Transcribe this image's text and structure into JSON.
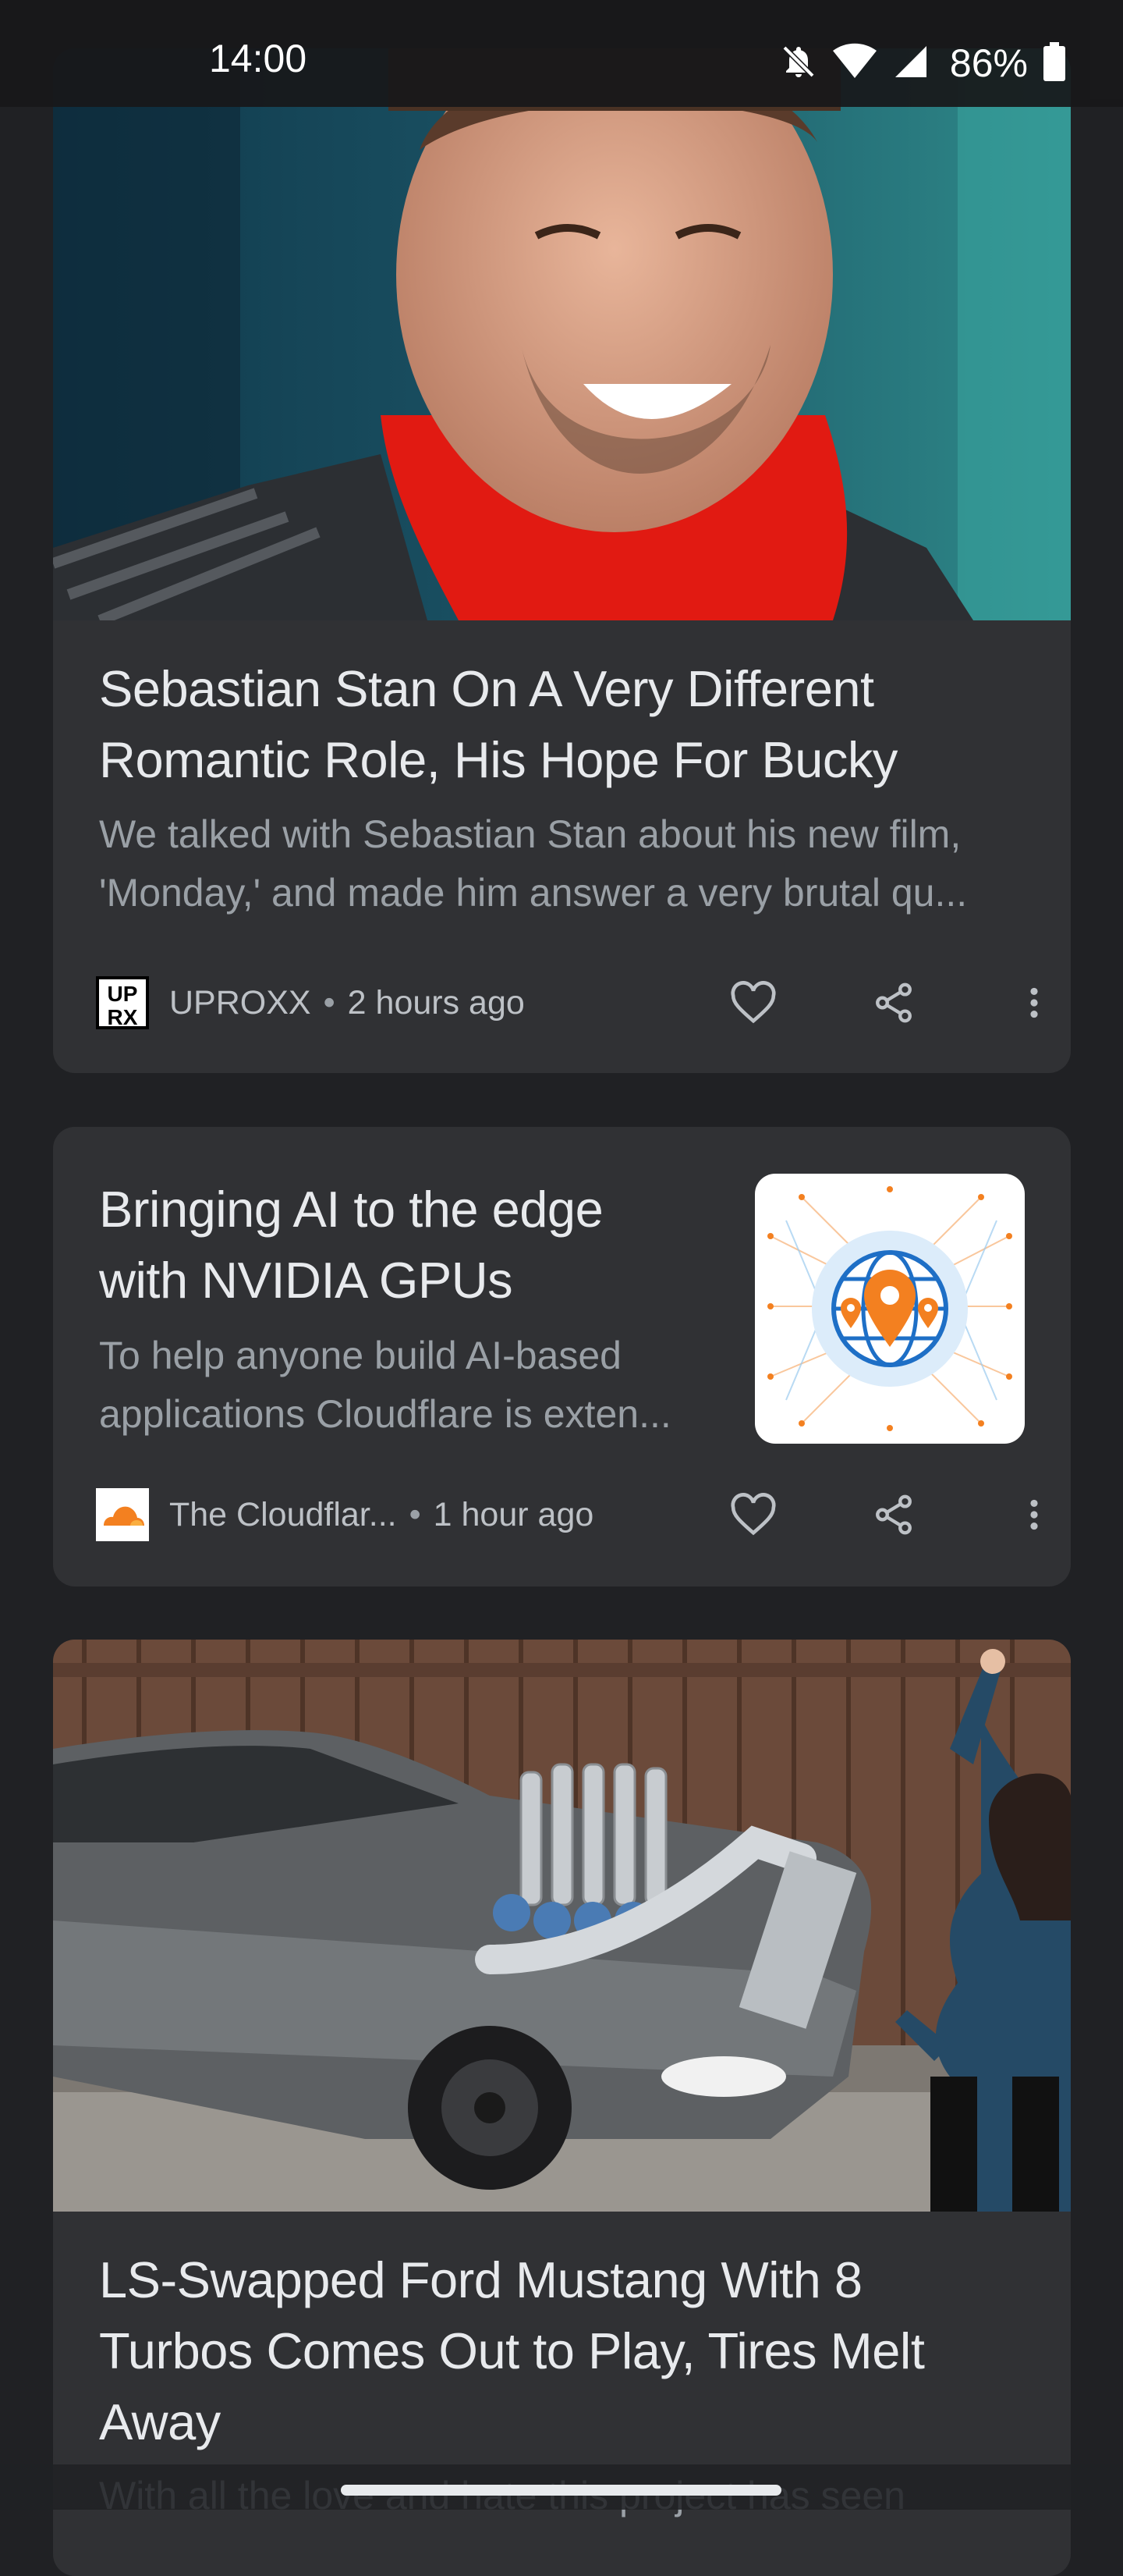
{
  "status_bar": {
    "time": "14:00",
    "battery": "86%",
    "icons": [
      "mute-bell-icon",
      "wifi-icon",
      "signal-icon",
      "battery-icon"
    ]
  },
  "cards": [
    {
      "title_lines": [
        "Sebastian Stan On A Very Different",
        "Romantic Role, His Hope For Bucky"
      ],
      "desc_lines": [
        "We talked with Sebastian Stan about his new film,",
        "'Monday,' and made him answer a very brutal qu..."
      ],
      "source": "UPROXX",
      "source_logo_text": [
        "UP",
        "RX"
      ],
      "time": "2 hours ago"
    },
    {
      "title_lines": [
        "Bringing AI to the edge",
        "with NVIDIA GPUs"
      ],
      "desc_lines": [
        "To help anyone build AI-based",
        "applications Cloudflare is exten..."
      ],
      "source": "The Cloudflar...",
      "time": "1 hour ago"
    },
    {
      "title_lines": [
        "LS-Swapped Ford Mustang With 8",
        "Turbos Comes Out to Play, Tires Melt",
        "Away"
      ],
      "desc_lines": [
        "With all the love and hate this project has seen"
      ]
    }
  ],
  "separator": "•",
  "colors": {
    "background": "#202124",
    "card": "#303134",
    "accent_orange": "#f38020"
  }
}
